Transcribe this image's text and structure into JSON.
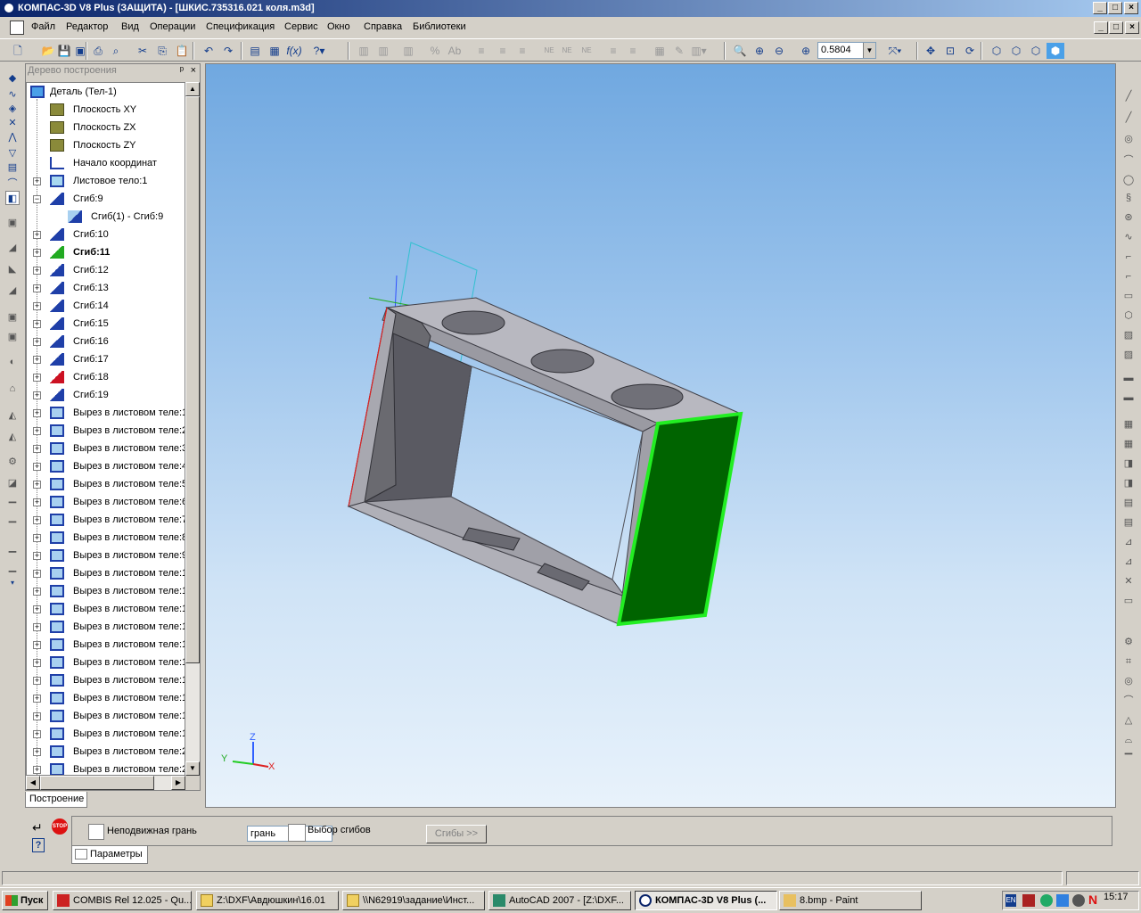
{
  "window": {
    "title": "КОМПАС-3D V8 Plus (ЗАЩИТА) - [ШКИС.735316.021 коля.m3d]",
    "min": "_",
    "max": "□",
    "close": "×"
  },
  "menu": [
    "Файл",
    "Редактор",
    "Вид",
    "Операции",
    "Спецификация",
    "Сервис",
    "Окно",
    "Справка",
    "Библиотеки"
  ],
  "toolbar": {
    "zoom_value": "0.5804"
  },
  "tree": {
    "header": "Дерево построения",
    "pin": "ᵖ",
    "close": "×",
    "root": "Деталь (Тел-1)",
    "items": [
      {
        "label": "Плоскость XY",
        "icon": "plane-icon",
        "level": 1,
        "expand": ""
      },
      {
        "label": "Плоскость ZX",
        "icon": "plane-icon",
        "level": 1,
        "expand": ""
      },
      {
        "label": "Плоскость ZY",
        "icon": "plane-icon",
        "level": 1,
        "expand": ""
      },
      {
        "label": "Начало координат",
        "icon": "origin-icon",
        "level": 1,
        "expand": ""
      },
      {
        "label": "Листовое тело:1",
        "icon": "sheet-body-icon",
        "level": 1,
        "expand": "+"
      },
      {
        "label": "Сгиб:9",
        "icon": "bend-icon",
        "level": 1,
        "expand": "−"
      },
      {
        "label": "Сгиб(1) -  Сгиб:9",
        "icon": "bend-sub-icon",
        "level": 2,
        "expand": ""
      },
      {
        "label": "Сгиб:10",
        "icon": "bend-icon",
        "level": 1,
        "expand": "+"
      },
      {
        "label": "Сгиб:11",
        "icon": "bend-green-icon",
        "level": 1,
        "expand": "+",
        "bold": true
      },
      {
        "label": "Сгиб:12",
        "icon": "bend-icon",
        "level": 1,
        "expand": "+"
      },
      {
        "label": "Сгиб:13",
        "icon": "bend-icon",
        "level": 1,
        "expand": "+"
      },
      {
        "label": "Сгиб:14",
        "icon": "bend-icon",
        "level": 1,
        "expand": "+"
      },
      {
        "label": "Сгиб:15",
        "icon": "bend-icon",
        "level": 1,
        "expand": "+"
      },
      {
        "label": "Сгиб:16",
        "icon": "bend-icon",
        "level": 1,
        "expand": "+"
      },
      {
        "label": "Сгиб:17",
        "icon": "bend-icon",
        "level": 1,
        "expand": "+"
      },
      {
        "label": "Сгиб:18",
        "icon": "bend-red-icon",
        "level": 1,
        "expand": "+"
      },
      {
        "label": "Сгиб:19",
        "icon": "bend-icon",
        "level": 1,
        "expand": "+"
      },
      {
        "label": "Вырез в листовом теле:1",
        "icon": "cut-icon",
        "level": 1,
        "expand": "+"
      },
      {
        "label": "Вырез в листовом теле:2",
        "icon": "cut-icon",
        "level": 1,
        "expand": "+"
      },
      {
        "label": "Вырез в листовом теле:3",
        "icon": "cut-icon",
        "level": 1,
        "expand": "+"
      },
      {
        "label": "Вырез в листовом теле:4",
        "icon": "cut-icon",
        "level": 1,
        "expand": "+"
      },
      {
        "label": "Вырез в листовом теле:5",
        "icon": "cut-icon",
        "level": 1,
        "expand": "+"
      },
      {
        "label": "Вырез в листовом теле:6",
        "icon": "cut-icon",
        "level": 1,
        "expand": "+"
      },
      {
        "label": "Вырез в листовом теле:7",
        "icon": "cut-icon",
        "level": 1,
        "expand": "+"
      },
      {
        "label": "Вырез в листовом теле:8",
        "icon": "cut-icon",
        "level": 1,
        "expand": "+"
      },
      {
        "label": "Вырез в листовом теле:9",
        "icon": "cut-icon",
        "level": 1,
        "expand": "+"
      },
      {
        "label": "Вырез в листовом теле:1",
        "icon": "cut-icon",
        "level": 1,
        "expand": "+"
      },
      {
        "label": "Вырез в листовом теле:1",
        "icon": "cut-icon",
        "level": 1,
        "expand": "+"
      },
      {
        "label": "Вырез в листовом теле:1",
        "icon": "cut-icon",
        "level": 1,
        "expand": "+"
      },
      {
        "label": "Вырез в листовом теле:1",
        "icon": "cut-icon",
        "level": 1,
        "expand": "+"
      },
      {
        "label": "Вырез в листовом теле:1",
        "icon": "cut-icon",
        "level": 1,
        "expand": "+"
      },
      {
        "label": "Вырез в листовом теле:1",
        "icon": "cut-icon",
        "level": 1,
        "expand": "+"
      },
      {
        "label": "Вырез в листовом теле:1",
        "icon": "cut-icon",
        "level": 1,
        "expand": "+"
      },
      {
        "label": "Вырез в листовом теле:1",
        "icon": "cut-icon",
        "level": 1,
        "expand": "+"
      },
      {
        "label": "Вырез в листовом теле:1",
        "icon": "cut-icon",
        "level": 1,
        "expand": "+"
      },
      {
        "label": "Вырез в листовом теле:1",
        "icon": "cut-icon",
        "level": 1,
        "expand": "+"
      },
      {
        "label": "Вырез в листовом теле:2",
        "icon": "cut-icon",
        "level": 1,
        "expand": "+"
      },
      {
        "label": "Вырез в листовом теле:2",
        "icon": "cut-icon",
        "level": 1,
        "expand": "+"
      }
    ],
    "tab": "Построение"
  },
  "viewport": {
    "axis_x": "X",
    "axis_y": "Y",
    "axis_z": "Z",
    "selected_face_color": "#006400",
    "selected_edge_color": "#22ee22"
  },
  "properties": {
    "fixed_face_label": "Неподвижная грань",
    "fixed_face_value": "грань",
    "choose_bends_label": "Выбор сгибов",
    "bends_button": "Сгибы  >>",
    "tab": "Параметры"
  },
  "taskbar": {
    "start": "Пуск",
    "tasks": [
      {
        "label": "COMBIS Rel 12.025 - Qu...",
        "icon": "combis-icon",
        "active": false
      },
      {
        "label": "Z:\\DXF\\Авдюшкин\\16.01",
        "icon": "folder-icon",
        "active": false
      },
      {
        "label": "\\\\N62919\\задание\\Инст...",
        "icon": "folder-icon",
        "active": false
      },
      {
        "label": "AutoCAD 2007 - [Z:\\DXF...",
        "icon": "autocad-icon",
        "active": false
      },
      {
        "label": "КОМПАС-3D V8 Plus (...",
        "icon": "kompas-icon",
        "active": true
      },
      {
        "label": "8.bmp - Paint",
        "icon": "paint-icon",
        "active": false
      }
    ],
    "lang": "EN",
    "clock": "15:17"
  }
}
